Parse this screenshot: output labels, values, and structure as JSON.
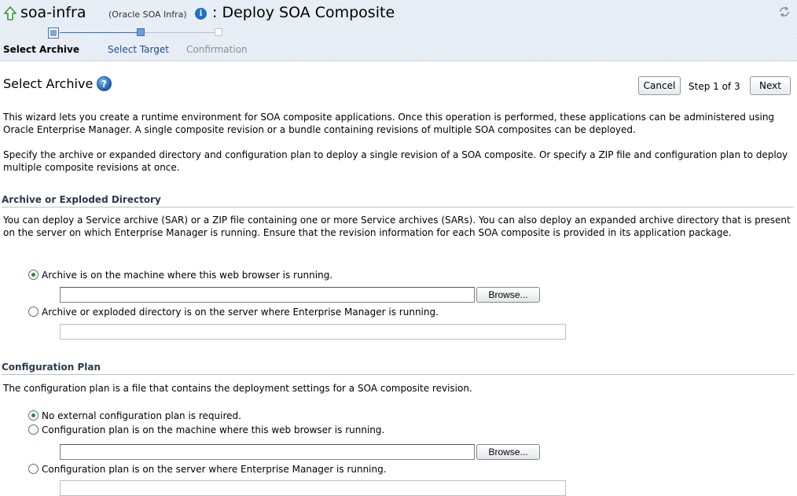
{
  "header": {
    "app_name": "soa-infra",
    "app_sub": "(Oracle SOA Infra)",
    "page_title": ": Deploy SOA Composite",
    "icons": {
      "home": "home-icon",
      "info": "info-icon",
      "refresh": "refresh-icon"
    }
  },
  "train": {
    "steps": [
      "Select Archive",
      "Select Target",
      "Confirmation"
    ],
    "current_step": 1
  },
  "section": {
    "title": "Select Archive",
    "cancel_label": "Cancel",
    "step_text": "Step 1 of 3",
    "next_label": "Next"
  },
  "intro": {
    "p1": "This wizard lets you create a runtime environment for SOA composite applications. Once this operation is performed, these applications can be administered using Oracle Enterprise Manager. A single composite revision or a bundle containing revisions of multiple SOA composites can be deployed.",
    "p2": "Specify the archive or expanded directory and configuration plan to deploy a single revision of a SOA composite. Or specify a ZIP file and configuration plan to deploy multiple composite revisions at once."
  },
  "archive": {
    "heading": "Archive or Exploded Directory",
    "description": "You can deploy a Service archive (SAR) or a ZIP file containing one or more Service archives (SARs). You can also deploy an expanded archive directory that is present on the server on which Enterprise Manager is running. Ensure that the revision information for each SOA composite is provided in its application package.",
    "option_local": "Archive is on the machine where this web browser is running.",
    "option_server": "Archive or exploded directory is on the server where Enterprise Manager is running.",
    "local_value": "",
    "server_value": "",
    "browse_label": "Browse...",
    "selected": "local"
  },
  "config": {
    "heading": "Configuration Plan",
    "description": "The configuration plan is a file that contains the deployment settings for a SOA composite revision.",
    "option_none": "No external configuration plan is required.",
    "option_local": "Configuration plan is on the machine where this web browser is running.",
    "option_server": "Configuration plan is on the server where Enterprise Manager is running.",
    "local_value": "",
    "server_value": "",
    "browse_label": "Browse...",
    "selected": "none"
  },
  "colors": {
    "header_bg": "#e4ebf4",
    "link": "#1a4e95",
    "disabled": "#8a8f96",
    "accent": "#1f6fc8"
  }
}
